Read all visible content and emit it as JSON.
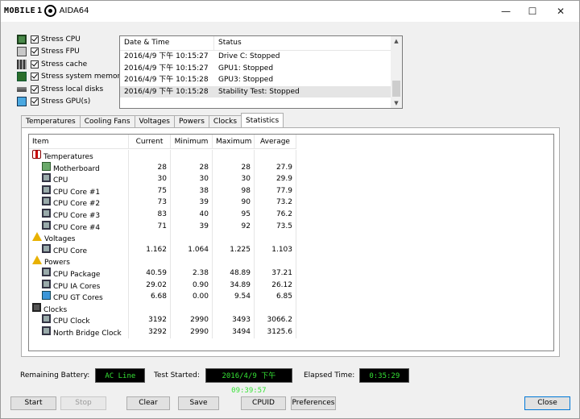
{
  "titlebar": {
    "logo_text": "MOBILE",
    "logo_suffix": "1",
    "app_title": "AIDA64",
    "minimize_glyph": "—",
    "maximize_glyph": "☐",
    "close_glyph": "✕"
  },
  "stress": {
    "items": [
      {
        "label": "Stress CPU",
        "checked": true,
        "icon": "cpu-icon"
      },
      {
        "label": "Stress FPU",
        "checked": true,
        "icon": "fpu-icon"
      },
      {
        "label": "Stress cache",
        "checked": true,
        "icon": "cache-icon"
      },
      {
        "label": "Stress system memory",
        "checked": true,
        "icon": "memory-icon"
      },
      {
        "label": "Stress local disks",
        "checked": true,
        "icon": "disk-icon"
      },
      {
        "label": "Stress GPU(s)",
        "checked": true,
        "icon": "gpu-icon"
      }
    ]
  },
  "log": {
    "col_date": "Date & Time",
    "col_status": "Status",
    "rows": [
      {
        "date": "2016/4/9 下午 10:15:27",
        "status": "Drive C: Stopped"
      },
      {
        "date": "2016/4/9 下午 10:15:27",
        "status": "GPU1: Stopped"
      },
      {
        "date": "2016/4/9 下午 10:15:28",
        "status": "GPU3: Stopped"
      },
      {
        "date": "2016/4/9 下午 10:15:28",
        "status": "Stability Test: Stopped"
      }
    ],
    "up_glyph": "▲",
    "down_glyph": "▼"
  },
  "tabs": [
    "Temperatures",
    "Cooling Fans",
    "Voltages",
    "Powers",
    "Clocks",
    "Statistics"
  ],
  "active_tab": "Statistics",
  "stats": {
    "headers": {
      "item": "Item",
      "current": "Current",
      "minimum": "Minimum",
      "maximum": "Maximum",
      "average": "Average"
    },
    "rows": [
      {
        "type": "group",
        "label": "Temperatures",
        "icon": "thermometer-icon"
      },
      {
        "type": "item",
        "label": "Motherboard",
        "icon": "motherboard-icon",
        "current": "28",
        "minimum": "28",
        "maximum": "28",
        "average": "27.9"
      },
      {
        "type": "item",
        "label": "CPU",
        "icon": "cpu-icon",
        "current": "30",
        "minimum": "30",
        "maximum": "30",
        "average": "29.9"
      },
      {
        "type": "item",
        "label": "CPU Core #1",
        "icon": "cpu-icon",
        "current": "75",
        "minimum": "38",
        "maximum": "98",
        "average": "77.9"
      },
      {
        "type": "item",
        "label": "CPU Core #2",
        "icon": "cpu-icon",
        "current": "73",
        "minimum": "39",
        "maximum": "90",
        "average": "73.2"
      },
      {
        "type": "item",
        "label": "CPU Core #3",
        "icon": "cpu-icon",
        "current": "83",
        "minimum": "40",
        "maximum": "95",
        "average": "76.2"
      },
      {
        "type": "item",
        "label": "CPU Core #4",
        "icon": "cpu-icon",
        "current": "71",
        "minimum": "39",
        "maximum": "92",
        "average": "73.5"
      },
      {
        "type": "group",
        "label": "Voltages",
        "icon": "warning-icon"
      },
      {
        "type": "item",
        "label": "CPU Core",
        "icon": "cpu-icon",
        "current": "1.162",
        "minimum": "1.064",
        "maximum": "1.225",
        "average": "1.103"
      },
      {
        "type": "group",
        "label": "Powers",
        "icon": "warning-icon"
      },
      {
        "type": "item",
        "label": "CPU Package",
        "icon": "cpu-icon",
        "current": "40.59",
        "minimum": "2.38",
        "maximum": "48.89",
        "average": "37.21"
      },
      {
        "type": "item",
        "label": "CPU IA Cores",
        "icon": "cpu-icon",
        "current": "29.02",
        "minimum": "0.90",
        "maximum": "34.89",
        "average": "26.12"
      },
      {
        "type": "item",
        "label": "CPU GT Cores",
        "icon": "gpu-icon",
        "current": "6.68",
        "minimum": "0.00",
        "maximum": "9.54",
        "average": "6.85"
      },
      {
        "type": "group",
        "label": "Clocks",
        "icon": "clock-icon"
      },
      {
        "type": "item",
        "label": "CPU Clock",
        "icon": "cpu-icon",
        "current": "3192",
        "minimum": "2990",
        "maximum": "3493",
        "average": "3066.2"
      },
      {
        "type": "item",
        "label": "North Bridge Clock",
        "icon": "cpu-icon",
        "current": "3292",
        "minimum": "2990",
        "maximum": "3494",
        "average": "3125.6"
      }
    ]
  },
  "status": {
    "battery_label": "Remaining Battery:",
    "battery_value": "AC Line",
    "started_label": "Test Started:",
    "started_value": "2016/4/9 下午 09:39:57",
    "elapsed_label": "Elapsed Time:",
    "elapsed_value": "0:35:29"
  },
  "buttons": {
    "start": "Start",
    "stop": "Stop",
    "clear": "Clear",
    "save": "Save",
    "cpuid": "CPUID",
    "preferences": "Preferences",
    "close": "Close"
  },
  "colors": {
    "lcd_text": "#35e235",
    "lcd_bg": "#000000",
    "selection": "#e5e5e5"
  }
}
